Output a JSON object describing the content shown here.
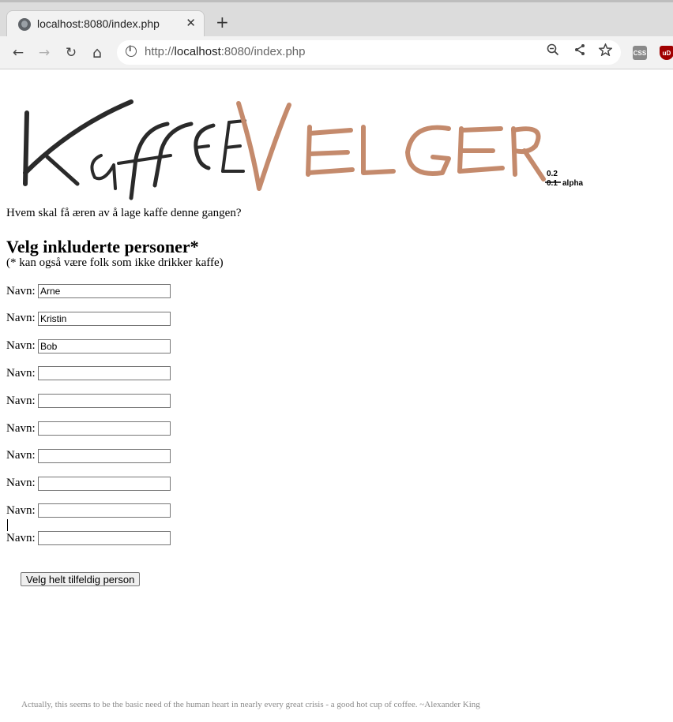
{
  "browser": {
    "tab_title": "localhost:8080/index.php",
    "tab_close": "✕",
    "new_tab": "+",
    "url_prefix": "http://",
    "url_host": "localhost",
    "url_rest": ":8080/index.php",
    "nav": {
      "back": "←",
      "forward": "→",
      "reload": "↻",
      "home": "⌂"
    },
    "omnibox_icons": {
      "zoom": "zoom-out-icon",
      "share": "share-icon",
      "bookmark": "star-icon"
    },
    "extensions": [
      {
        "name": "css-extension-icon",
        "label": "CSS",
        "color": "#8a8a8a"
      },
      {
        "name": "ublock-icon",
        "label": "uD",
        "color": "#a00000"
      }
    ]
  },
  "page": {
    "logo": {
      "word1": "KaffE",
      "word2": "VELGER",
      "version_top": "0.2",
      "version_old": "0.1",
      "version_suffix": "alpha"
    },
    "intro": "Hvem skal få æren av å lage kaffe denne gangen?",
    "heading": "Velg inkluderte personer*",
    "subnote": "(* kan også være folk som ikke drikker kaffe)",
    "name_label": "Navn:",
    "names": [
      "Arne",
      "Kristin",
      "Bob",
      "",
      "",
      "",
      "",
      "",
      "",
      ""
    ],
    "pick_button": "Velg helt tilfeldig person",
    "quote": "Actually, this seems to be the basic need of the human heart in nearly every great crisis - a good hot cup of coffee. ~Alexander King"
  },
  "colors": {
    "logo_dark": "#2a2a2a",
    "logo_brown": "#c48a6c",
    "tab_bg": "#f2f2f2",
    "toolbar_bg": "#f2f2f2"
  }
}
